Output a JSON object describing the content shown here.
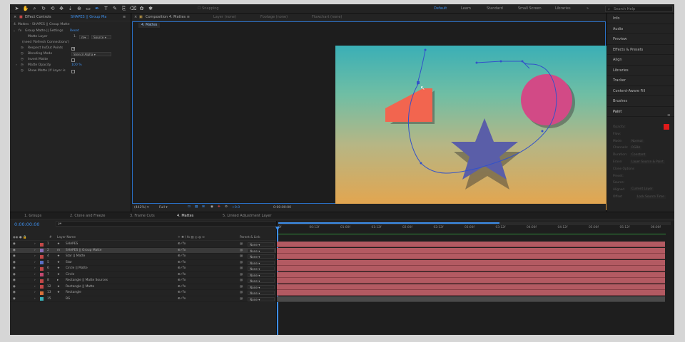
{
  "colors": {
    "accent": "#3d8eea",
    "timeline_bar": "#b35a62",
    "shape_red": "#f2654f",
    "shape_pink": "#d24a86",
    "shape_star": "#5a5ea8"
  },
  "toolbar": {
    "tools": [
      "selection-tool-icon",
      "hand-tool-icon",
      "zoom-tool-icon",
      "rotate-tool-icon",
      "orbit-tool-icon",
      "pan-tool-icon",
      "dolly-tool-icon",
      "anchor-tool-icon",
      "rectangle-tool-icon",
      "pen-tool-icon",
      "type-tool-icon",
      "brush-tool-icon",
      "clone-tool-icon",
      "eraser-tool-icon",
      "roto-tool-icon",
      "puppet-tool-icon"
    ],
    "snapping": "Snapping",
    "workspaces": [
      "Default",
      "Learn",
      "Standard",
      "Small Screen",
      "Libraries"
    ],
    "search_placeholder": "Search Help"
  },
  "effect_controls": {
    "tab1": "Effect Controls",
    "tab1_layer": "SHAPES || Group Ma",
    "breadcrumb": "4. Mattes  ·  SHAPES || Group Matte",
    "effect_name": "Group Matte || Settings",
    "reset": "Reset",
    "matte_layer_label": "Matte Layer",
    "matte_layer_num": "1.",
    "matte_source": "Source",
    "refresh": "(need 'Refresh Connections')",
    "respect_label": "Respect In/Out Points",
    "blending_label": "Blending Mode",
    "blending_value": "Stencil Alpha",
    "invert_label": "Invert Matte",
    "opacity_label": "Matte Opacity",
    "opacity_value": "100 %",
    "show_label": "Show Matte (If Layer is"
  },
  "viewer": {
    "tab": "Composition 4. Mattes",
    "tabs_dim": [
      "Layer (none)",
      "Footage (none)",
      "Flowchart (none)"
    ],
    "sub_tab": "4. Mattes",
    "zoom": "(442%)",
    "resolution": "Full",
    "exposure": "+0.0",
    "timecode": "0:00:00:00"
  },
  "right_panel": {
    "items": [
      "Info",
      "Audio",
      "Preview",
      "Effects & Presets",
      "Align",
      "Libraries",
      "Tracker",
      "Content-Aware Fill",
      "Brushes",
      "Paint"
    ],
    "paint_rows": [
      "Opacity:",
      "Flow:",
      "Mode:",
      "Channels:",
      "Duration:",
      "Erase:",
      "Clone Options",
      "Preset:",
      "Source:",
      "Aligned",
      "Offset"
    ],
    "paint_values": [
      "Normal",
      "RGBA",
      "Constant",
      "Layer Source & Paint",
      "Current Layer",
      "Lock Source Time"
    ]
  },
  "timeline": {
    "tabs": [
      "1. Groups",
      "2. Clone and Freeze",
      "3. Frame Cuts",
      "4. Mattes",
      "5. Linked Adjustment Layer"
    ],
    "timecode": "0:00:00:00",
    "search_placeholder": "ρ▾",
    "col_num": "#",
    "col_name": "Layer Name",
    "col_parent": "Parent & Link",
    "ticks": [
      "0f",
      "00:12f",
      "01:00f",
      "01:12f",
      "02:00f",
      "02:12f",
      "03:00f",
      "03:12f",
      "04:00f",
      "04:12f",
      "05:00f",
      "05:12f",
      "06:00f"
    ],
    "layers": [
      {
        "num": "1",
        "name": "SHAPES",
        "color": "#c24848",
        "parent": "None",
        "prefix": "★"
      },
      {
        "num": "2",
        "name": "SHAPES || Group Matte",
        "color": "#8c6fb8",
        "parent": "None",
        "prefix": "m"
      },
      {
        "num": "4",
        "name": "Star || Matte",
        "color": "#c24848",
        "parent": "None",
        "prefix": "★"
      },
      {
        "num": "5",
        "name": "Star",
        "color": "#5a6fc4",
        "parent": "None",
        "prefix": "★"
      },
      {
        "num": "6",
        "name": "Circle || Matte",
        "color": "#c24848",
        "parent": "None",
        "prefix": "★"
      },
      {
        "num": "7",
        "name": "Circle",
        "color": "#c24870",
        "parent": "None",
        "prefix": "★"
      },
      {
        "num": "8",
        "name": "Rectangle || Matte Sources",
        "color": "#c24848",
        "parent": "None",
        "prefix": "▸"
      },
      {
        "num": "12",
        "name": "Rectangle || Matte",
        "color": "#c24848",
        "parent": "None",
        "prefix": "★"
      },
      {
        "num": "13",
        "name": "Rectangle",
        "color": "#d8703a",
        "parent": "None",
        "prefix": "★"
      },
      {
        "num": "15",
        "name": "BG",
        "color": "#3aafb6",
        "parent": "None",
        "prefix": ""
      }
    ]
  }
}
